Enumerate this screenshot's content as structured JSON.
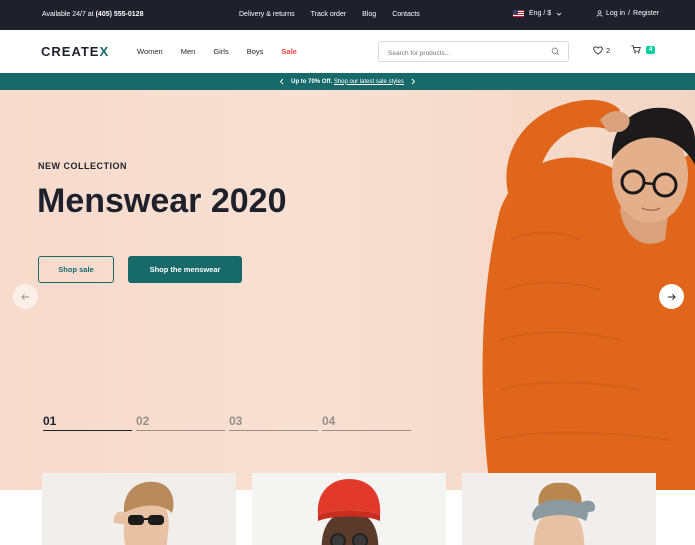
{
  "topbar": {
    "availability_prefix": "Available 24/7 at",
    "phone": "(405) 555-0128",
    "links": [
      "Delivery & returns",
      "Track order",
      "Blog",
      "Contacts"
    ],
    "language": "Eng / $",
    "login": "Log in",
    "separator": "/",
    "register": "Register"
  },
  "header": {
    "logo_main": "CREATE",
    "logo_accent": "X",
    "nav": [
      "Women",
      "Men",
      "Girls",
      "Boys"
    ],
    "nav_sale": "Sale",
    "search_placeholder": "Search for products...",
    "wishlist_count": "2",
    "cart_count": "4"
  },
  "promo": {
    "bold": "Up to 70% Off.",
    "link": "Shop our latest sale styles"
  },
  "hero": {
    "kicker": "NEW COLLECTION",
    "headline": "Menswear 2020",
    "btn_sale": "Shop sale",
    "btn_menswear": "Shop the menswear",
    "pages": [
      "01",
      "02",
      "03",
      "04"
    ],
    "active_page": "01"
  },
  "colors": {
    "primary": "#17696a",
    "dark": "#1e212c",
    "sale": "#ff4242",
    "badge": "#03cea4",
    "hero_bg": "#f7dbcc",
    "sweater": "#e0661c"
  },
  "icons": [
    "flag-us-icon",
    "chevron-down-icon",
    "user-icon",
    "search-icon",
    "heart-icon",
    "cart-icon",
    "chevron-left-icon",
    "chevron-right-icon",
    "arrow-left-icon",
    "arrow-right-icon"
  ]
}
